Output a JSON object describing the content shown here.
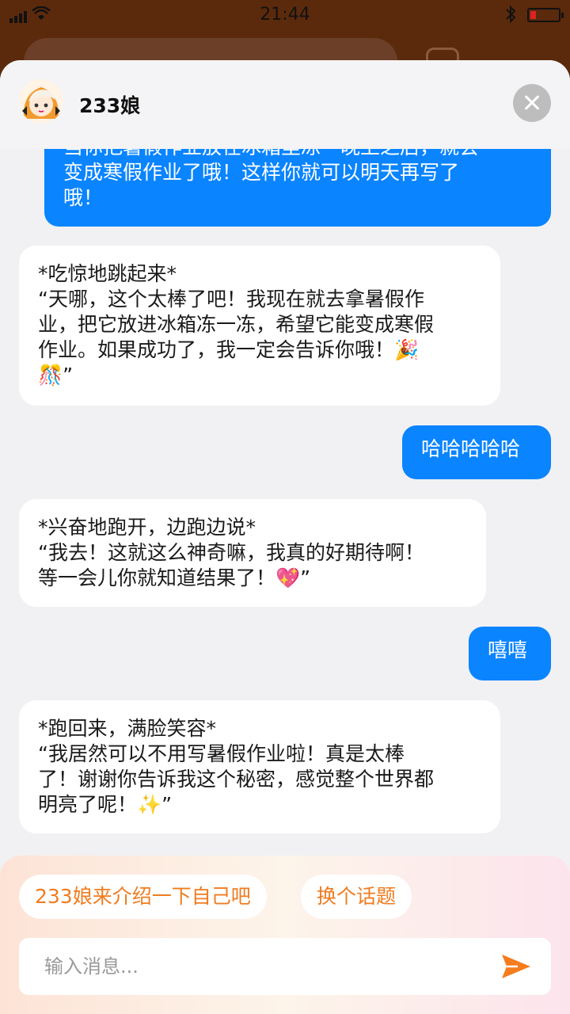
{
  "status_bar": {
    "time": "21:44",
    "battery_level": 0.2
  },
  "header": {
    "title": "233娘"
  },
  "messages": [
    {
      "role": "user",
      "text": "当你把暑假作业放在冰箱里冻一晚上之后，就会\n变成寒假作业了哦！这样你就可以明天再写了\n哦！"
    },
    {
      "role": "bot",
      "text": "*吃惊地跳起来*\n“天哪，这个太棒了吧！我现在就去拿暑假作\n业，把它放进冰箱冻一冻，希望它能变成寒假\n作业。如果成功了，我一定会告诉你哦！🎉\n🎊”"
    },
    {
      "role": "user",
      "text": "哈哈哈哈哈"
    },
    {
      "role": "bot",
      "text": "*兴奋地跑开，边跑边说*\n“我去！这就这么神奇嘛，我真的好期待啊！\n等一会儿你就知道结果了！💖”"
    },
    {
      "role": "user",
      "text": "嘻嘻"
    },
    {
      "role": "bot",
      "text": "*跑回来，满脸笑容*\n“我居然可以不用写暑假作业啦！真是太棒\n了！谢谢你告诉我这个秘密，感觉整个世界都\n明亮了呢！✨”"
    }
  ],
  "suggestions": [
    "233娘来介绍一下自己吧",
    "换个话题"
  ],
  "input": {
    "placeholder": "输入消息..."
  },
  "colors": {
    "user_bubble": "#0a84ff",
    "accent": "#f07c20",
    "sheet_bg": "#f1f1f3"
  },
  "icons": {
    "close": "close-icon",
    "send": "send-icon",
    "bluetooth": "bluetooth-icon",
    "wifi": "wifi-icon"
  }
}
